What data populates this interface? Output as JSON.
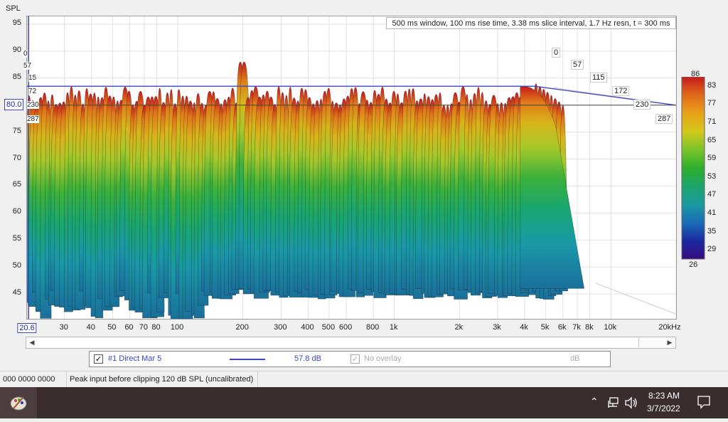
{
  "chart_data": {
    "type": "waterfall",
    "title": "500 ms window, 100 ms rise time, 3.38 ms slice interval, 1.7 Hz resn, t = 300 ms",
    "ylabel": "SPL",
    "xlabel_unit": "Hz",
    "x_scale": "log",
    "xlim": [
      20.6,
      20000
    ],
    "ylim": [
      40,
      96
    ],
    "x_ticks": [
      "20.6",
      "30",
      "40",
      "50",
      "60",
      "70",
      "80",
      "100",
      "200",
      "300",
      "400",
      "500",
      "600",
      "800",
      "1k",
      "2k",
      "3k",
      "4k",
      "5k",
      "6k",
      "7k",
      "8k",
      "10k",
      "20kHz"
    ],
    "y_ticks": [
      "95",
      "90",
      "85",
      "80",
      "75",
      "70",
      "65",
      "60",
      "55",
      "50",
      "45"
    ],
    "time_axis_labels_left": [
      "0",
      "57",
      "15",
      "72",
      "230",
      "287"
    ],
    "time_axis_labels_right": [
      "0",
      "57",
      "115",
      "172",
      "230",
      "287"
    ],
    "cursor_level": "80.0",
    "frequency_range_of_response": [
      20.6,
      6000
    ],
    "peak_approx": {
      "frequency": 200,
      "spl": 88
    },
    "colorbar": {
      "ticks": [
        "86",
        "83",
        "77",
        "71",
        "65",
        "59",
        "53",
        "47",
        "41",
        "35",
        "29",
        "26"
      ],
      "max": 86,
      "min": 26
    }
  },
  "legend": {
    "item1_label": "#1 Direct Mar 5",
    "item1_value": "57.8 dB",
    "item1_color": "#3b46c7",
    "item2_label": "No overlay",
    "item2_unit": "dB"
  },
  "status": {
    "cell1": "000  0000 0000",
    "cell2": "Peak input before clipping 120 dB SPL (uncalibrated)"
  },
  "taskbar": {
    "time": "8:23 AM",
    "date": "3/7/2022"
  },
  "icons": {
    "taskbar_app": "paint-palette-icon",
    "tray_up": "chevron-up-icon",
    "network": "network-icon",
    "volume": "speaker-icon",
    "notifications": "notification-icon"
  }
}
